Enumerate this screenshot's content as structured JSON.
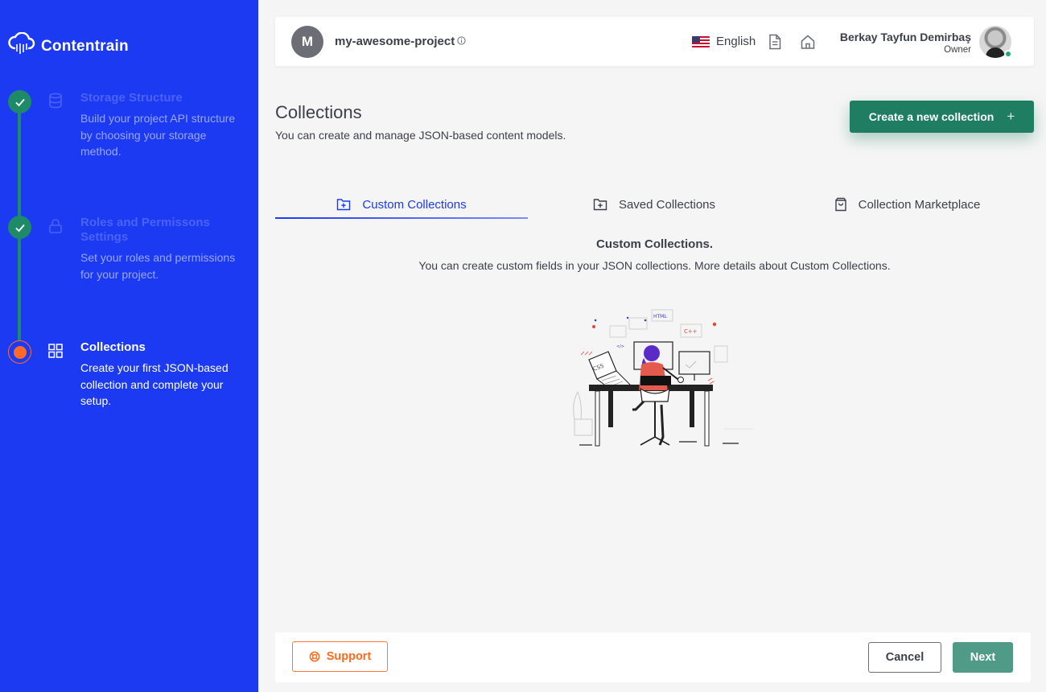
{
  "brand": {
    "name": "Contentrain",
    "icon": "cloud-rain-icon"
  },
  "steps": [
    {
      "title": "Storage Structure",
      "description": "Build your project API structure by choosing your storage method.",
      "status": "done",
      "icon": "database-icon"
    },
    {
      "title": "Roles and Permissons Settings",
      "description": "Set your roles and permissions for your project.",
      "status": "done",
      "icon": "lock-icon"
    },
    {
      "title": "Collections",
      "description": "Create your first JSON-based collection and complete your setup.",
      "status": "active",
      "icon": "grid-icon"
    }
  ],
  "header": {
    "project_initial": "M",
    "project_name": "my-awesome-project",
    "language": "English",
    "user_name": "Berkay Tayfun Demirbaş",
    "user_role": "Owner"
  },
  "page": {
    "title": "Collections",
    "subtitle": "You can create and manage JSON-based content models.",
    "create_button": "Create a new collection"
  },
  "tabs": [
    {
      "label": "Custom Collections",
      "active": true,
      "icon": "folder-plus-icon"
    },
    {
      "label": "Saved Collections",
      "active": false,
      "icon": "folder-plus-icon"
    },
    {
      "label": "Collection Marketplace",
      "active": false,
      "icon": "shopping-bag-icon"
    }
  ],
  "content": {
    "title": "Custom Collections.",
    "description": "You can create custom fields in your JSON collections. More details about Custom Collections."
  },
  "footer": {
    "support": "Support",
    "cancel": "Cancel",
    "next": "Next"
  },
  "colors": {
    "sidebar": "#1b3af2",
    "accent_green": "#1f7d62",
    "accent_orange": "#ff6a2b",
    "tab_active": "#1b3af2"
  }
}
